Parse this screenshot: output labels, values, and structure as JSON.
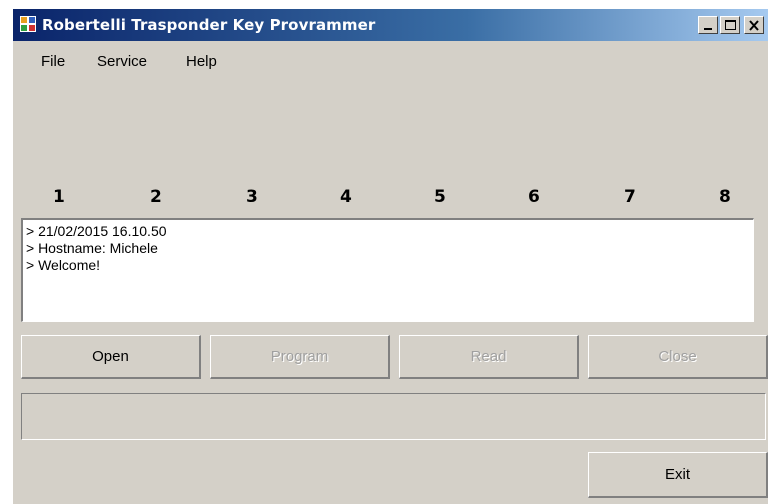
{
  "window": {
    "title": "Robertelli Trasponder Key Provrammer",
    "title_bar_colors": [
      "#0a246a",
      "#a6caf0"
    ],
    "controls": [
      "minimize-icon",
      "maximize-icon",
      "close-icon"
    ]
  },
  "menu": {
    "items": [
      {
        "label": "File"
      },
      {
        "label": "Service"
      },
      {
        "label": "Help"
      }
    ]
  },
  "slots": [
    "1",
    "2",
    "3",
    "4",
    "5",
    "6",
    "7",
    "8"
  ],
  "log": {
    "lines": [
      "> 21/02/2015 16.10.50",
      "> Hostname: Michele",
      "> Welcome!"
    ]
  },
  "buttons": {
    "open": {
      "label": "Open",
      "enabled": true
    },
    "program": {
      "label": "Program",
      "enabled": false
    },
    "read": {
      "label": "Read",
      "enabled": false
    },
    "close": {
      "label": "Close",
      "enabled": false
    },
    "exit": {
      "label": "Exit",
      "enabled": true
    }
  },
  "status": {
    "text": ""
  }
}
